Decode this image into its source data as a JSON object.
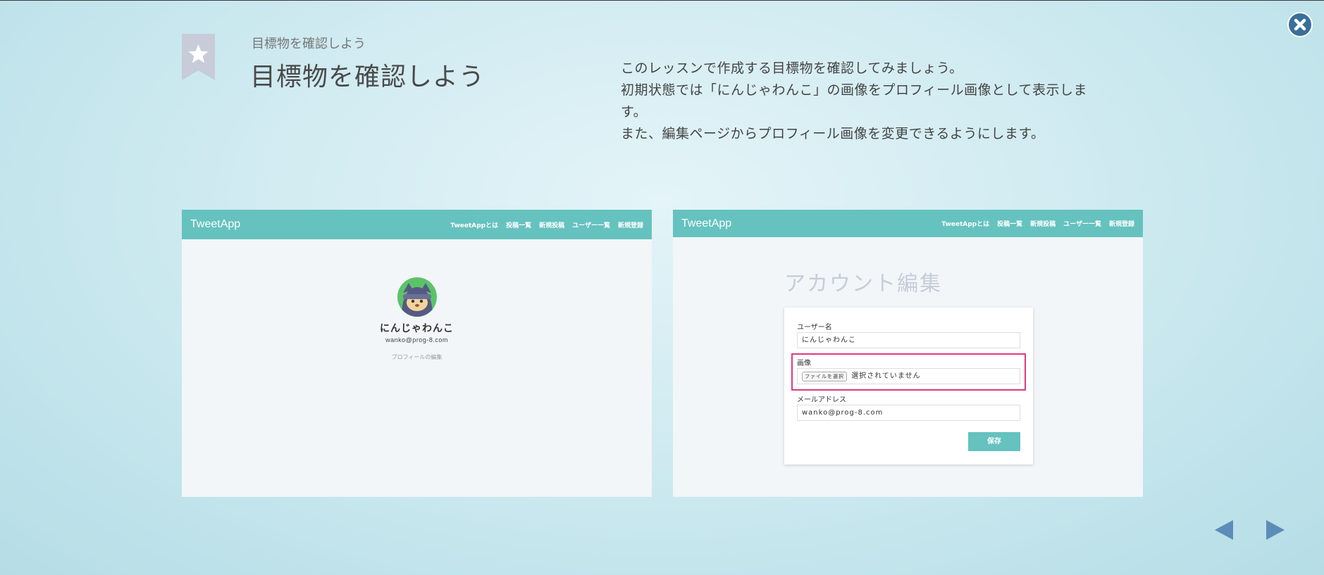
{
  "header": {
    "subtitle": "目標物を確認しよう",
    "title": "目標物を確認しよう",
    "description": [
      "このレッスンで作成する目標物を確認してみましょう。",
      "初期状態では「にんじゃわんこ」の画像をプロフィール画像として表示しま",
      "す。",
      "また、編集ページからプロフィール画像を変更できるようにします。"
    ]
  },
  "app": {
    "brand": "TweetApp",
    "nav": [
      "TweetAppとは",
      "投稿一覧",
      "新規投稿",
      "ユーザー一覧",
      "新規登録"
    ]
  },
  "profile_page": {
    "name": "にんじゃわんこ",
    "email": "wanko@prog-8.com",
    "edit_link": "プロフィールの編集"
  },
  "edit_page": {
    "title": "アカウント編集",
    "username_label": "ユーザー名",
    "username_value": "にんじゃわんこ",
    "image_label": "画像",
    "file_button": "ファイルを選択",
    "file_status": "選択されていません",
    "email_label": "メールアドレス",
    "email_value": "wanko@prog-8.com",
    "save_label": "保存"
  },
  "colors": {
    "app_header": "#65c2bf",
    "highlight": "#e0397d",
    "close_button": "#3a6f9a",
    "nav_arrows": "#5b8db8"
  }
}
